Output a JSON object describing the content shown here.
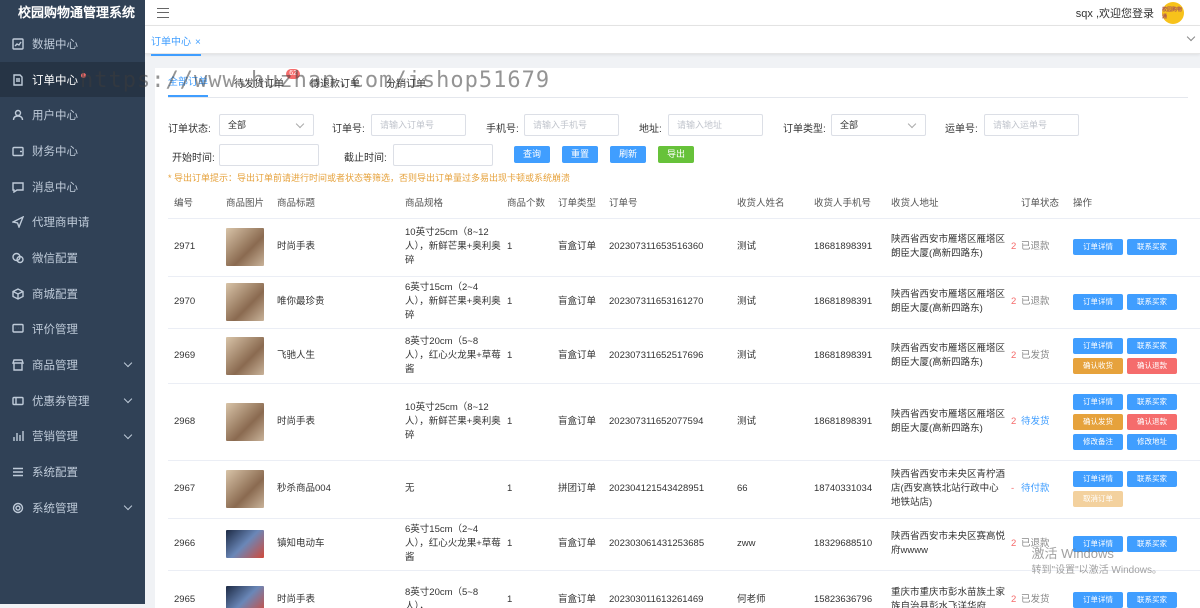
{
  "app": {
    "title": "校园购物通管理系统"
  },
  "sidebar": {
    "items": [
      {
        "label": "数据中心",
        "icon": "chart-icon"
      },
      {
        "label": "订单中心",
        "icon": "document-icon",
        "active": true,
        "dot": true
      },
      {
        "label": "用户中心",
        "icon": "user-icon"
      },
      {
        "label": "财务中心",
        "icon": "wallet-icon"
      },
      {
        "label": "消息中心",
        "icon": "message-icon"
      },
      {
        "label": "代理商申请",
        "icon": "send-icon"
      },
      {
        "label": "微信配置",
        "icon": "wechat-icon"
      },
      {
        "label": "商城配置",
        "icon": "box-icon"
      },
      {
        "label": "评价管理",
        "icon": "comment-icon"
      },
      {
        "label": "商品管理",
        "icon": "store-icon",
        "expand": true
      },
      {
        "label": "优惠券管理",
        "icon": "coupon-icon",
        "expand": true
      },
      {
        "label": "营销管理",
        "icon": "bar-icon",
        "expand": true
      },
      {
        "label": "系统配置",
        "icon": "list-icon"
      },
      {
        "label": "系统管理",
        "icon": "gear-icon",
        "expand": true
      }
    ]
  },
  "header": {
    "greeting": "sqx ,欢迎您登录",
    "avatar_text": "校园购物通"
  },
  "tagsview": {
    "tab": "订单中心",
    "close": "×"
  },
  "tabs": [
    {
      "label": "全部订单",
      "active": true
    },
    {
      "label": "待发货订单",
      "badge": "62"
    },
    {
      "label": "待退款订单"
    },
    {
      "label": "分销订单"
    }
  ],
  "filters": {
    "status_label": "订单状态:",
    "status_value": "全部",
    "order_no_label": "订单号:",
    "order_no_placeholder": "请输入订单号",
    "phone_label": "手机号:",
    "phone_placeholder": "请输入手机号",
    "address_label": "地址:",
    "address_placeholder": "请输入地址",
    "type_label": "订单类型:",
    "type_value": "全部",
    "waybill_label": "运单号:",
    "waybill_placeholder": "请输入运单号",
    "start_label": "开始时间:",
    "end_label": "截止时间:",
    "btn_query": "查询",
    "btn_reset": "重置",
    "btn_refresh": "刷新",
    "btn_export": "导出"
  },
  "notice": "* 导出订单提示：导出订单前请进行时间或者状态等筛选，否则导出订单量过多易出现卡顿或系统崩溃",
  "watermark": "https://www.huzhan.com/ishop51679",
  "table": {
    "headers": [
      "编号",
      "商品图片",
      "商品标题",
      "商品规格",
      "商品个数",
      "订单类型",
      "订单号",
      "收货人姓名",
      "收货人手机号",
      "收货人地址",
      "",
      "订单状态",
      "操作"
    ],
    "rows": [
      {
        "id": "2971",
        "title": "时尚手表",
        "spec": "10英寸25cm（8~12人），新鲜芒果+奥利奥碎",
        "count": "1",
        "type": "盲盒订单",
        "order_no": "2023073116535163​60",
        "name": "测试",
        "phone": "18681898391",
        "address": "陕西省西安市雁塔区雁塔区朗臣大厦(高新四路东)",
        "mark": "2",
        "status": "已退款",
        "status_style": "gray",
        "ops": [
          [
            "订单详情",
            "blue"
          ],
          [
            "联系买家",
            "blue"
          ]
        ]
      },
      {
        "id": "2970",
        "title": "唯你最珍贵",
        "spec": "6英寸15cm（2~4人），新鲜芒果+奥利奥碎",
        "count": "1",
        "type": "盲盒订单",
        "order_no": "202307311653161270",
        "name": "测试",
        "phone": "18681898391",
        "address": "陕西省西安市雁塔区雁塔区朗臣大厦(高新四路东)",
        "mark": "2",
        "status": "已退款",
        "status_style": "gray",
        "ops": [
          [
            "订单详情",
            "blue"
          ],
          [
            "联系买家",
            "blue"
          ]
        ]
      },
      {
        "id": "2969",
        "title": "飞驰人生",
        "spec": "8英寸20cm（5~8人），红心火龙果+草莓酱",
        "count": "1",
        "type": "盲盒订单",
        "order_no": "202307311652517696",
        "name": "测试",
        "phone": "18681898391",
        "address": "陕西省西安市雁塔区雁塔区朗臣大厦(高新四路东)",
        "mark": "2",
        "status": "已发货",
        "status_style": "gray",
        "ops": [
          [
            "订单详情",
            "blue"
          ],
          [
            "联系买家",
            "blue"
          ],
          [
            "确认收货",
            "orange"
          ],
          [
            "确认退款",
            "red"
          ]
        ]
      },
      {
        "id": "2968",
        "title": "时尚手表",
        "spec": "10英寸25cm（8~12人），新鲜芒果+奥利奥碎",
        "count": "1",
        "type": "盲盒订单",
        "order_no": "202307311652077594",
        "name": "测试",
        "phone": "18681898391",
        "address": "陕西省西安市雁塔区雁塔区朗臣大厦(高新四路东)",
        "mark": "2",
        "status": "待发货",
        "status_style": "blue",
        "ops": [
          [
            "订单详情",
            "blue"
          ],
          [
            "联系买家",
            "blue"
          ],
          [
            "确认发货",
            "orange"
          ],
          [
            "确认退款",
            "red"
          ],
          [
            "修改备注",
            "blue"
          ],
          [
            "修改地址",
            "blue"
          ]
        ]
      },
      {
        "id": "2967",
        "title": "秒杀商品004",
        "spec": "无",
        "count": "1",
        "type": "拼团订单",
        "order_no": "202304121543428951",
        "name": "66",
        "phone": "18740331034",
        "address": "陕西省西安市未央区青柠酒店(西安高铁北站行政中心地铁站店)",
        "mark": "-",
        "status": "待付款",
        "status_style": "blue",
        "ops": [
          [
            "订单详情",
            "blue"
          ],
          [
            "联系买家",
            "blue"
          ],
          [
            "取消订单",
            "lightorange"
          ]
        ]
      },
      {
        "id": "2966",
        "title": "镇知电动车",
        "spec": "6英寸15cm（2~4人），红心火龙果+草莓酱",
        "count": "1",
        "type": "盲盒订单",
        "order_no": "202303061431253685",
        "name": "zww",
        "phone": "18329688510",
        "address": "陕西省西安市未央区赛高悦府wwww",
        "mark": "2",
        "status": "已退款",
        "status_style": "gray",
        "ops": [
          [
            "订单详情",
            "blue"
          ],
          [
            "联系买家",
            "blue"
          ]
        ]
      },
      {
        "id": "2965",
        "title": "时尚手表",
        "spec": "8英寸20cm（5~8人），",
        "count": "1",
        "type": "盲盒订单",
        "order_no": "202303011613261469",
        "name": "何老师",
        "phone": "15823636796",
        "address": "重庆市重庆市彭水苗族土家族自治县彭水飞洋华府",
        "mark": "2",
        "status": "已发货",
        "status_style": "gray",
        "ops": [
          [
            "订单详情",
            "blue"
          ],
          [
            "联系买家",
            "blue"
          ]
        ]
      }
    ]
  },
  "windows_watermark": {
    "line1": "激活 Windows",
    "line2": "转到\"设置\"以激活 Windows。"
  }
}
